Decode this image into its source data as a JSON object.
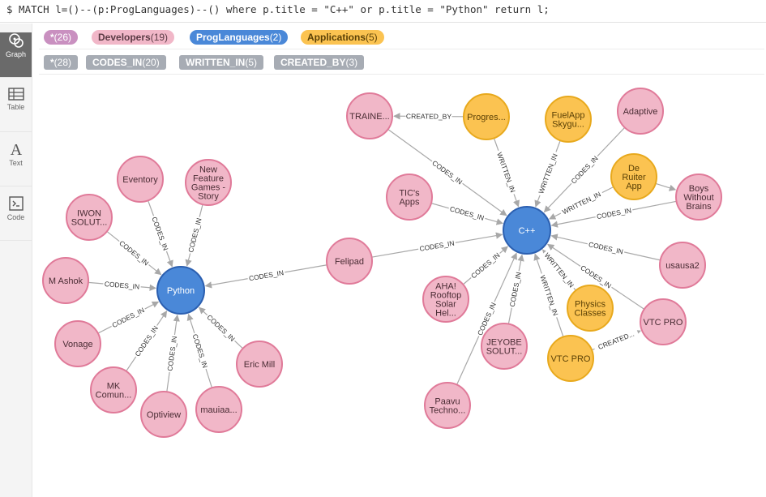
{
  "query": {
    "text": "$ MATCH l=()--(p:ProgLanguages)--() where p.title = \"C++\" or p.title = \"Python\" return l;"
  },
  "sidebar": {
    "items": [
      {
        "label": "Graph",
        "icon": "graph-icon",
        "active": true
      },
      {
        "label": "Table",
        "icon": "table-icon",
        "active": false
      },
      {
        "label": "Text",
        "icon": "text-icon",
        "active": false
      },
      {
        "label": "Code",
        "icon": "code-icon",
        "active": false
      }
    ]
  },
  "node_labels": [
    {
      "name": "*",
      "count": "(26)",
      "color": "#c990c0",
      "text_color": "#ffffff"
    },
    {
      "name": "Developers",
      "count": "(19)",
      "color": "#f1b7c8",
      "text_color": "#5a3a44"
    },
    {
      "name": "ProgLanguages",
      "count": "(2)",
      "color": "#4a88d8",
      "text_color": "#ffffff"
    },
    {
      "name": "Applications",
      "count": "(5)",
      "color": "#fbc351",
      "text_color": "#5b4106"
    }
  ],
  "rel_types": [
    {
      "name": "*",
      "count": "(28)"
    },
    {
      "name": "CODES_IN",
      "count": "(20)"
    },
    {
      "name": "WRITTEN_IN",
      "count": "(5)"
    },
    {
      "name": "CREATED_BY",
      "count": "(3)"
    }
  ],
  "colors": {
    "developer_fill": "#f1b7c8",
    "developer_stroke": "#e07a99",
    "language_fill": "#4a88d8",
    "language_stroke": "#2b5fb0",
    "application_fill": "#fbc351",
    "application_stroke": "#e8a91d",
    "edge": "#a8a8a8"
  },
  "graph": {
    "nodes": [
      {
        "id": "python",
        "type": "language",
        "lines": [
          "Python"
        ]
      },
      {
        "id": "cpp",
        "type": "language",
        "lines": [
          "C++"
        ]
      },
      {
        "id": "eventory",
        "type": "developer",
        "lines": [
          "Eventory"
        ]
      },
      {
        "id": "nfgs",
        "type": "developer",
        "lines": [
          "New",
          "Feature",
          "Games -",
          "Story"
        ]
      },
      {
        "id": "iwon",
        "type": "developer",
        "lines": [
          "IWON",
          "SOLUT..."
        ]
      },
      {
        "id": "mashok",
        "type": "developer",
        "lines": [
          "M Ashok"
        ]
      },
      {
        "id": "vonage",
        "type": "developer",
        "lines": [
          "Vonage"
        ]
      },
      {
        "id": "mk",
        "type": "developer",
        "lines": [
          "MK",
          "Comun..."
        ]
      },
      {
        "id": "optiview",
        "type": "developer",
        "lines": [
          "Optiview"
        ]
      },
      {
        "id": "mauiaa",
        "type": "developer",
        "lines": [
          "mauiaa..."
        ]
      },
      {
        "id": "ericmill",
        "type": "developer",
        "lines": [
          "Eric Mill"
        ]
      },
      {
        "id": "felipad",
        "type": "developer",
        "lines": [
          "Felipad"
        ]
      },
      {
        "id": "trainee",
        "type": "developer",
        "lines": [
          "TRAINE..."
        ]
      },
      {
        "id": "progres",
        "type": "application",
        "lines": [
          "Progres..."
        ]
      },
      {
        "id": "fuelapp",
        "type": "application",
        "lines": [
          "FuelApp",
          "Skygu..."
        ]
      },
      {
        "id": "adaptive",
        "type": "developer",
        "lines": [
          "Adaptive"
        ]
      },
      {
        "id": "deruiter",
        "type": "application",
        "lines": [
          "De",
          "Ruiter",
          "App"
        ]
      },
      {
        "id": "boys",
        "type": "developer",
        "lines": [
          "Boys",
          "Without",
          "Brains"
        ]
      },
      {
        "id": "tics",
        "type": "developer",
        "lines": [
          "TIC's",
          "Apps"
        ]
      },
      {
        "id": "usausa2",
        "type": "developer",
        "lines": [
          "usausa2"
        ]
      },
      {
        "id": "aha",
        "type": "developer",
        "lines": [
          "AHA!",
          "Rooftop",
          "Solar",
          "Hel..."
        ]
      },
      {
        "id": "physics",
        "type": "application",
        "lines": [
          "Physics",
          "Classes"
        ]
      },
      {
        "id": "vtcpro_dev",
        "type": "developer",
        "lines": [
          "VTC PRO"
        ]
      },
      {
        "id": "jeyobe",
        "type": "developer",
        "lines": [
          "JEYOBE",
          "SOLUT..."
        ]
      },
      {
        "id": "vtcpro_app",
        "type": "application",
        "lines": [
          "VTC PRO"
        ]
      },
      {
        "id": "paavu",
        "type": "developer",
        "lines": [
          "Paavu",
          "Techno..."
        ]
      }
    ],
    "edges": [
      {
        "from": "eventory",
        "to": "python",
        "label": "CODES_IN"
      },
      {
        "from": "nfgs",
        "to": "python",
        "label": "CODES_IN"
      },
      {
        "from": "iwon",
        "to": "python",
        "label": "CODES_IN"
      },
      {
        "from": "mashok",
        "to": "python",
        "label": "CODES_IN"
      },
      {
        "from": "vonage",
        "to": "python",
        "label": "CODES_IN"
      },
      {
        "from": "mk",
        "to": "python",
        "label": "CODES_IN"
      },
      {
        "from": "optiview",
        "to": "python",
        "label": "CODES_IN"
      },
      {
        "from": "mauiaa",
        "to": "python",
        "label": "CODES_IN"
      },
      {
        "from": "ericmill",
        "to": "python",
        "label": "CODES_IN"
      },
      {
        "from": "felipad",
        "to": "python",
        "label": "CODES_IN"
      },
      {
        "from": "felipad",
        "to": "cpp",
        "label": "CODES_IN"
      },
      {
        "from": "trainee",
        "to": "cpp",
        "label": "CODES_IN"
      },
      {
        "from": "progres",
        "to": "trainee",
        "label": "CREATED_BY"
      },
      {
        "from": "progres",
        "to": "cpp",
        "label": "WRITTEN_IN"
      },
      {
        "from": "fuelapp",
        "to": "cpp",
        "label": "WRITTEN_IN"
      },
      {
        "from": "adaptive",
        "to": "cpp",
        "label": "CODES_IN"
      },
      {
        "from": "deruiter",
        "to": "cpp",
        "label": "WRITTEN_IN"
      },
      {
        "from": "deruiter",
        "to": "boys",
        "label": ""
      },
      {
        "from": "boys",
        "to": "cpp",
        "label": "CODES_IN"
      },
      {
        "from": "tics",
        "to": "cpp",
        "label": "CODES_IN"
      },
      {
        "from": "usausa2",
        "to": "cpp",
        "label": "CODES_IN"
      },
      {
        "from": "aha",
        "to": "cpp",
        "label": "CODES_IN"
      },
      {
        "from": "physics",
        "to": "cpp",
        "label": "WRITTEN_IN"
      },
      {
        "from": "vtcpro_dev",
        "to": "cpp",
        "label": "CODES_IN"
      },
      {
        "from": "jeyobe",
        "to": "cpp",
        "label": "CODES_IN"
      },
      {
        "from": "vtcpro_app",
        "to": "cpp",
        "label": "WRITTEN_IN"
      },
      {
        "from": "vtcpro_app",
        "to": "vtcpro_dev",
        "label": "CREATED..."
      },
      {
        "from": "paavu",
        "to": "cpp",
        "label": "CODES_IN"
      }
    ]
  }
}
